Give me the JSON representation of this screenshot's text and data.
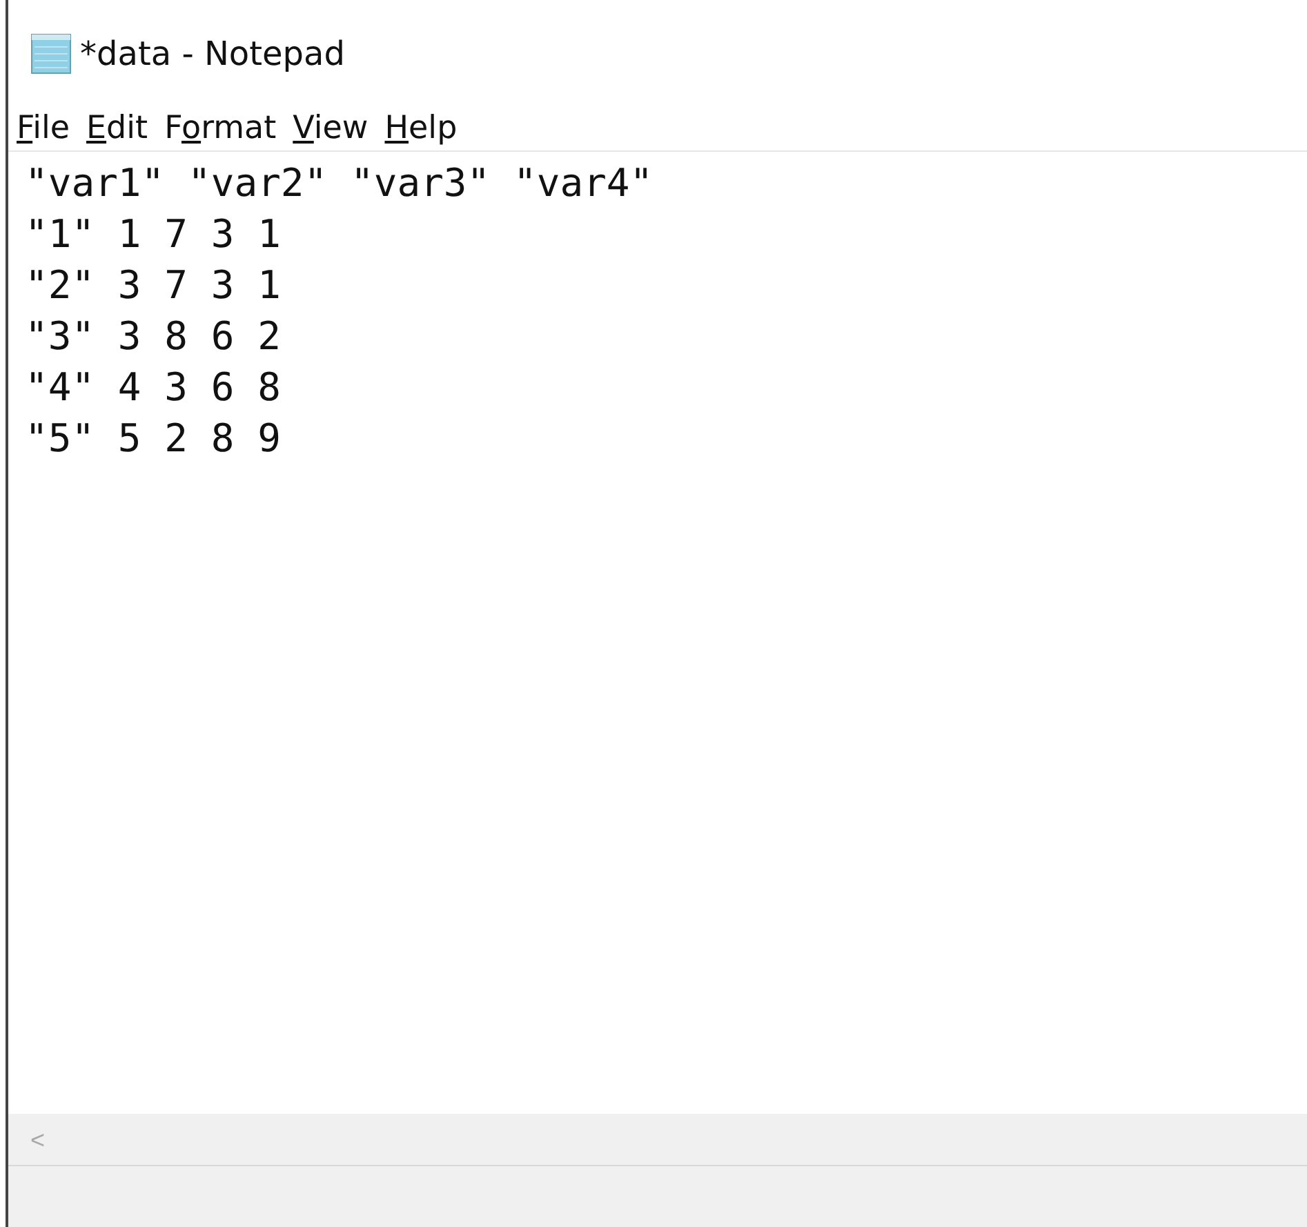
{
  "window": {
    "title": "*data - Notepad"
  },
  "menu": [
    {
      "access_key": "F",
      "after": "ile"
    },
    {
      "access_key": "E",
      "after": "dit"
    },
    {
      "before": "F",
      "access_key": "o",
      "after": "rmat"
    },
    {
      "access_key": "V",
      "after": "iew"
    },
    {
      "access_key": "H",
      "after": "elp"
    }
  ],
  "document_lines": [
    "\"var1\" \"var2\" \"var3\" \"var4\"",
    "\"1\" 1 7 3 1",
    "\"2\" 3 7 3 1",
    "\"3\" 3 8 6 2",
    "\"4\" 4 3 6 8",
    "\"5\" 5 2 8 9"
  ],
  "horizontal_scrollbar": {
    "left_arrow": "<"
  }
}
